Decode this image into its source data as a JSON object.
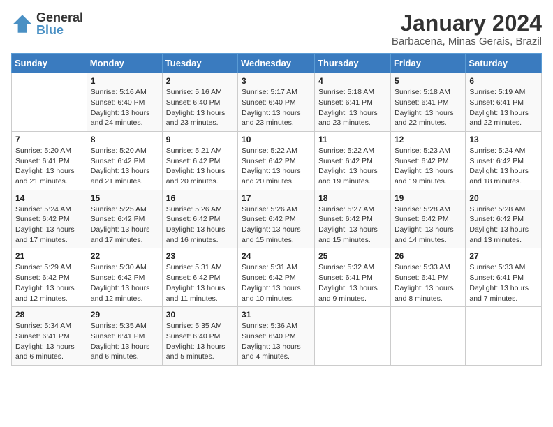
{
  "logo": {
    "line1": "General",
    "line2": "Blue"
  },
  "title": "January 2024",
  "subtitle": "Barbacena, Minas Gerais, Brazil",
  "weekdays": [
    "Sunday",
    "Monday",
    "Tuesday",
    "Wednesday",
    "Thursday",
    "Friday",
    "Saturday"
  ],
  "weeks": [
    [
      {
        "day": "",
        "info": ""
      },
      {
        "day": "1",
        "info": "Sunrise: 5:16 AM\nSunset: 6:40 PM\nDaylight: 13 hours\nand 24 minutes."
      },
      {
        "day": "2",
        "info": "Sunrise: 5:16 AM\nSunset: 6:40 PM\nDaylight: 13 hours\nand 23 minutes."
      },
      {
        "day": "3",
        "info": "Sunrise: 5:17 AM\nSunset: 6:40 PM\nDaylight: 13 hours\nand 23 minutes."
      },
      {
        "day": "4",
        "info": "Sunrise: 5:18 AM\nSunset: 6:41 PM\nDaylight: 13 hours\nand 23 minutes."
      },
      {
        "day": "5",
        "info": "Sunrise: 5:18 AM\nSunset: 6:41 PM\nDaylight: 13 hours\nand 22 minutes."
      },
      {
        "day": "6",
        "info": "Sunrise: 5:19 AM\nSunset: 6:41 PM\nDaylight: 13 hours\nand 22 minutes."
      }
    ],
    [
      {
        "day": "7",
        "info": "Sunrise: 5:20 AM\nSunset: 6:41 PM\nDaylight: 13 hours\nand 21 minutes."
      },
      {
        "day": "8",
        "info": "Sunrise: 5:20 AM\nSunset: 6:42 PM\nDaylight: 13 hours\nand 21 minutes."
      },
      {
        "day": "9",
        "info": "Sunrise: 5:21 AM\nSunset: 6:42 PM\nDaylight: 13 hours\nand 20 minutes."
      },
      {
        "day": "10",
        "info": "Sunrise: 5:22 AM\nSunset: 6:42 PM\nDaylight: 13 hours\nand 20 minutes."
      },
      {
        "day": "11",
        "info": "Sunrise: 5:22 AM\nSunset: 6:42 PM\nDaylight: 13 hours\nand 19 minutes."
      },
      {
        "day": "12",
        "info": "Sunrise: 5:23 AM\nSunset: 6:42 PM\nDaylight: 13 hours\nand 19 minutes."
      },
      {
        "day": "13",
        "info": "Sunrise: 5:24 AM\nSunset: 6:42 PM\nDaylight: 13 hours\nand 18 minutes."
      }
    ],
    [
      {
        "day": "14",
        "info": "Sunrise: 5:24 AM\nSunset: 6:42 PM\nDaylight: 13 hours\nand 17 minutes."
      },
      {
        "day": "15",
        "info": "Sunrise: 5:25 AM\nSunset: 6:42 PM\nDaylight: 13 hours\nand 17 minutes."
      },
      {
        "day": "16",
        "info": "Sunrise: 5:26 AM\nSunset: 6:42 PM\nDaylight: 13 hours\nand 16 minutes."
      },
      {
        "day": "17",
        "info": "Sunrise: 5:26 AM\nSunset: 6:42 PM\nDaylight: 13 hours\nand 15 minutes."
      },
      {
        "day": "18",
        "info": "Sunrise: 5:27 AM\nSunset: 6:42 PM\nDaylight: 13 hours\nand 15 minutes."
      },
      {
        "day": "19",
        "info": "Sunrise: 5:28 AM\nSunset: 6:42 PM\nDaylight: 13 hours\nand 14 minutes."
      },
      {
        "day": "20",
        "info": "Sunrise: 5:28 AM\nSunset: 6:42 PM\nDaylight: 13 hours\nand 13 minutes."
      }
    ],
    [
      {
        "day": "21",
        "info": "Sunrise: 5:29 AM\nSunset: 6:42 PM\nDaylight: 13 hours\nand 12 minutes."
      },
      {
        "day": "22",
        "info": "Sunrise: 5:30 AM\nSunset: 6:42 PM\nDaylight: 13 hours\nand 12 minutes."
      },
      {
        "day": "23",
        "info": "Sunrise: 5:31 AM\nSunset: 6:42 PM\nDaylight: 13 hours\nand 11 minutes."
      },
      {
        "day": "24",
        "info": "Sunrise: 5:31 AM\nSunset: 6:42 PM\nDaylight: 13 hours\nand 10 minutes."
      },
      {
        "day": "25",
        "info": "Sunrise: 5:32 AM\nSunset: 6:41 PM\nDaylight: 13 hours\nand 9 minutes."
      },
      {
        "day": "26",
        "info": "Sunrise: 5:33 AM\nSunset: 6:41 PM\nDaylight: 13 hours\nand 8 minutes."
      },
      {
        "day": "27",
        "info": "Sunrise: 5:33 AM\nSunset: 6:41 PM\nDaylight: 13 hours\nand 7 minutes."
      }
    ],
    [
      {
        "day": "28",
        "info": "Sunrise: 5:34 AM\nSunset: 6:41 PM\nDaylight: 13 hours\nand 6 minutes."
      },
      {
        "day": "29",
        "info": "Sunrise: 5:35 AM\nSunset: 6:41 PM\nDaylight: 13 hours\nand 6 minutes."
      },
      {
        "day": "30",
        "info": "Sunrise: 5:35 AM\nSunset: 6:40 PM\nDaylight: 13 hours\nand 5 minutes."
      },
      {
        "day": "31",
        "info": "Sunrise: 5:36 AM\nSunset: 6:40 PM\nDaylight: 13 hours\nand 4 minutes."
      },
      {
        "day": "",
        "info": ""
      },
      {
        "day": "",
        "info": ""
      },
      {
        "day": "",
        "info": ""
      }
    ]
  ]
}
